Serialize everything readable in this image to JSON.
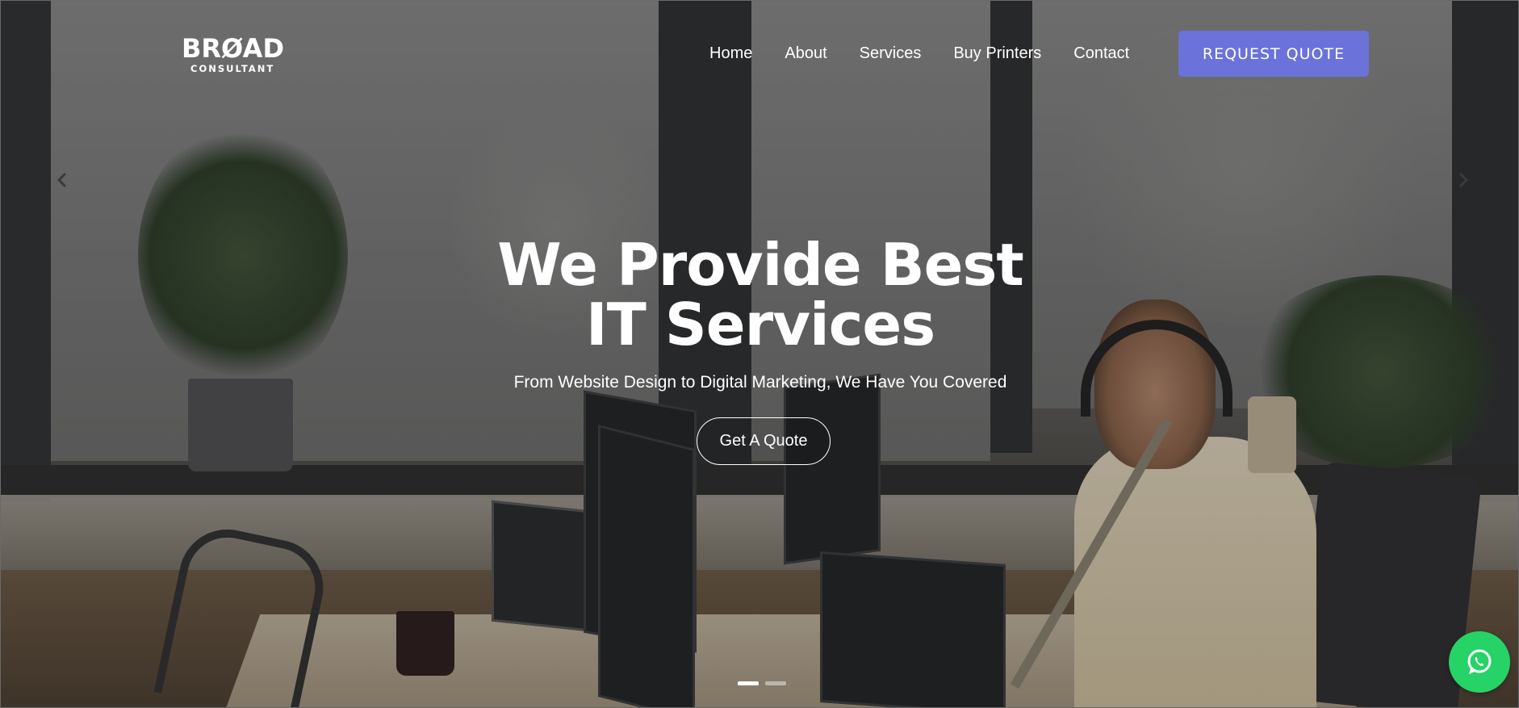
{
  "brand": {
    "logo_main": "BRØAD",
    "logo_sub": "CONSULTANT"
  },
  "nav": {
    "items": [
      {
        "label": "Home"
      },
      {
        "label": "About"
      },
      {
        "label": "Services"
      },
      {
        "label": "Buy Printers"
      },
      {
        "label": "Contact"
      }
    ],
    "cta_label": "REQUEST QUOTE"
  },
  "hero": {
    "title_line1": "We Provide Best",
    "title_line2": "IT Services",
    "subtitle": "From Website Design to Digital Marketing, We Have You Covered",
    "cta_label": "Get A Quote"
  },
  "slider": {
    "prev_icon": "chevron-left-icon",
    "next_icon": "chevron-right-icon",
    "slide_count": 2,
    "active_slide": 1
  },
  "colors": {
    "accent": "#6b72da",
    "whatsapp": "#25d366",
    "text": "#ffffff"
  },
  "floating": {
    "icon": "whatsapp-icon"
  }
}
